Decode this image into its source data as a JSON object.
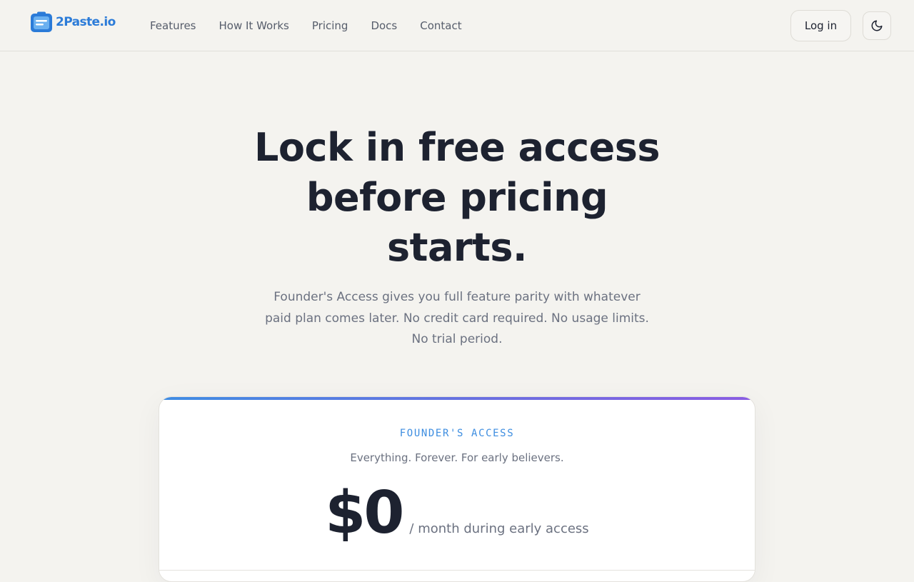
{
  "brand": {
    "name": "2Paste.io",
    "accent": "#2b7bd8"
  },
  "nav": {
    "items": [
      {
        "label": "Features"
      },
      {
        "label": "How It Works"
      },
      {
        "label": "Pricing"
      },
      {
        "label": "Docs"
      },
      {
        "label": "Contact"
      }
    ]
  },
  "header": {
    "login_label": "Log in",
    "theme_toggle_icon": "moon-icon"
  },
  "hero": {
    "title": "Lock in free access before pricing starts.",
    "subtitle": "Founder's Access gives you full feature parity with whatever paid plan comes later. No credit card required. No usage limits. No trial period."
  },
  "plan": {
    "eyebrow": "FOUNDER'S ACCESS",
    "tagline": "Everything. Forever. For early believers.",
    "price": "$0",
    "period": "/ month during early access",
    "accent_gradient": [
      "#3f8de3",
      "#6a6fe0",
      "#8a5de2"
    ]
  }
}
